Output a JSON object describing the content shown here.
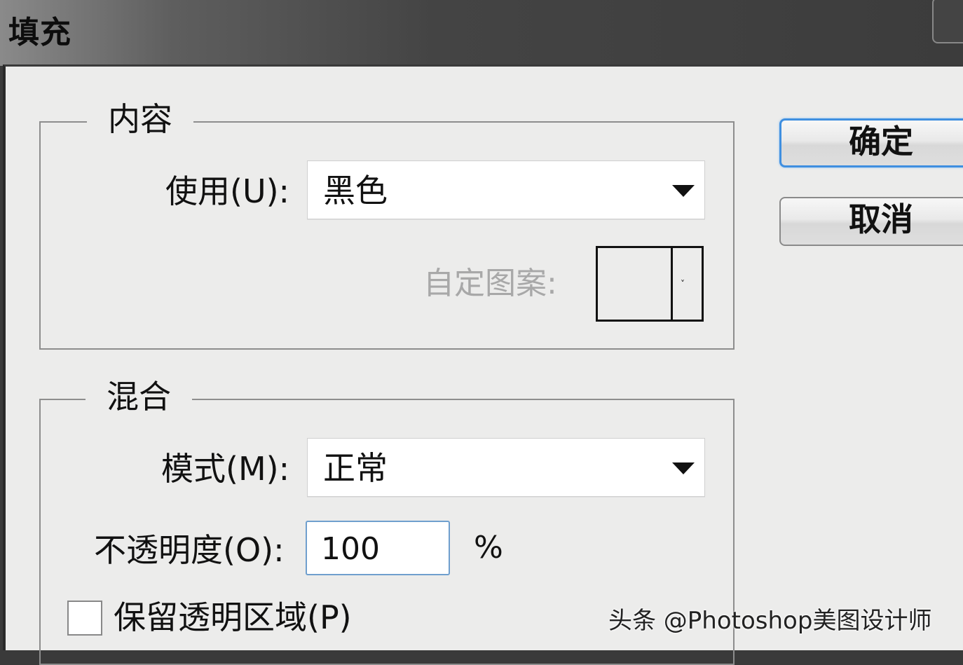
{
  "window": {
    "title": "填充"
  },
  "content_group": {
    "legend": "内容",
    "use_label": "使用(U):",
    "use_value": "黑色",
    "custom_pattern_label": "自定图案:"
  },
  "blend_group": {
    "legend": "混合",
    "mode_label": "模式(M):",
    "mode_value": "正常",
    "opacity_label": "不透明度(O):",
    "opacity_value": "100",
    "opacity_unit": "%",
    "preserve_transparency_label": "保留透明区域(P)",
    "preserve_transparency_checked": false
  },
  "buttons": {
    "ok": "确定",
    "cancel": "取消"
  },
  "watermark": "头条 @Photoshop美图设计师",
  "colors": {
    "dialog_bg": "#ececeb",
    "titlebar": "#3c3c3c",
    "focus_blue": "#3f8fe0",
    "disabled_text": "#a8a8a8"
  }
}
